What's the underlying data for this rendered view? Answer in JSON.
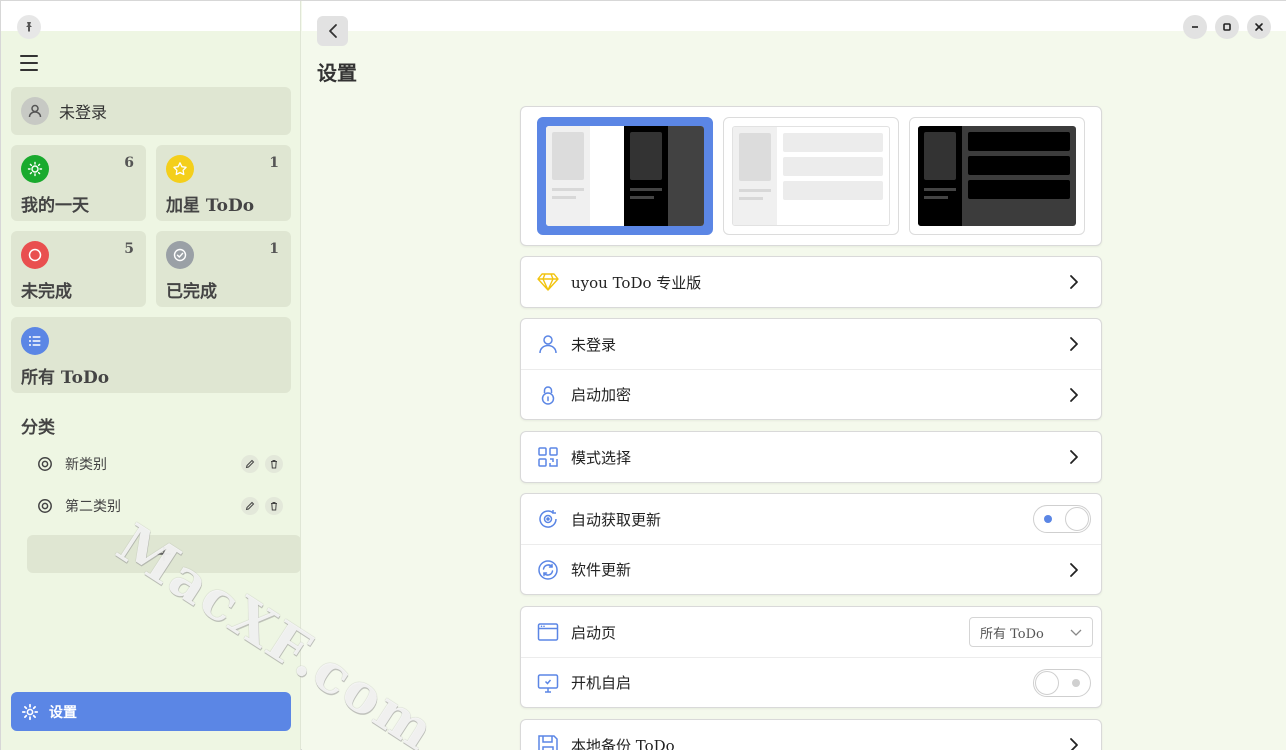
{
  "sidebar": {
    "user": {
      "name": "未登录"
    },
    "tiles": [
      {
        "label": "我的一天",
        "count": "6",
        "color": "#1aaa2e",
        "icon": "sun-icon"
      },
      {
        "label": "加星 ToDo",
        "count": "1",
        "color": "#f4cf1b",
        "icon": "star-icon"
      },
      {
        "label": "未完成",
        "count": "5",
        "color": "#e94f4f",
        "icon": "circle-icon"
      },
      {
        "label": "已完成",
        "count": "1",
        "color": "#9aa0a6",
        "icon": "check-circle-icon"
      },
      {
        "label": "所有 ToDo",
        "count": "",
        "color": "#5b86e5",
        "icon": "list-icon"
      }
    ],
    "categories_title": "分类",
    "categories": [
      {
        "label": "新类别"
      },
      {
        "label": "第二类别"
      }
    ],
    "add_label": "+",
    "settings_label": "设置"
  },
  "main": {
    "title": "设置",
    "accent_color": "#5b86e5",
    "pro": {
      "label": "uyou ToDo 专业版"
    },
    "account": [
      {
        "label": "未登录"
      },
      {
        "label": "启动加密"
      }
    ],
    "mode": {
      "label": "模式选择"
    },
    "update": [
      {
        "label": "自动获取更新",
        "toggle": true
      },
      {
        "label": "软件更新"
      }
    ],
    "launch": [
      {
        "label": "启动页",
        "value": "所有 ToDo"
      },
      {
        "label": "开机自启",
        "toggle": false
      }
    ],
    "backup": {
      "label": "本地备份 ToDo"
    }
  },
  "watermark": "MacXF.com"
}
